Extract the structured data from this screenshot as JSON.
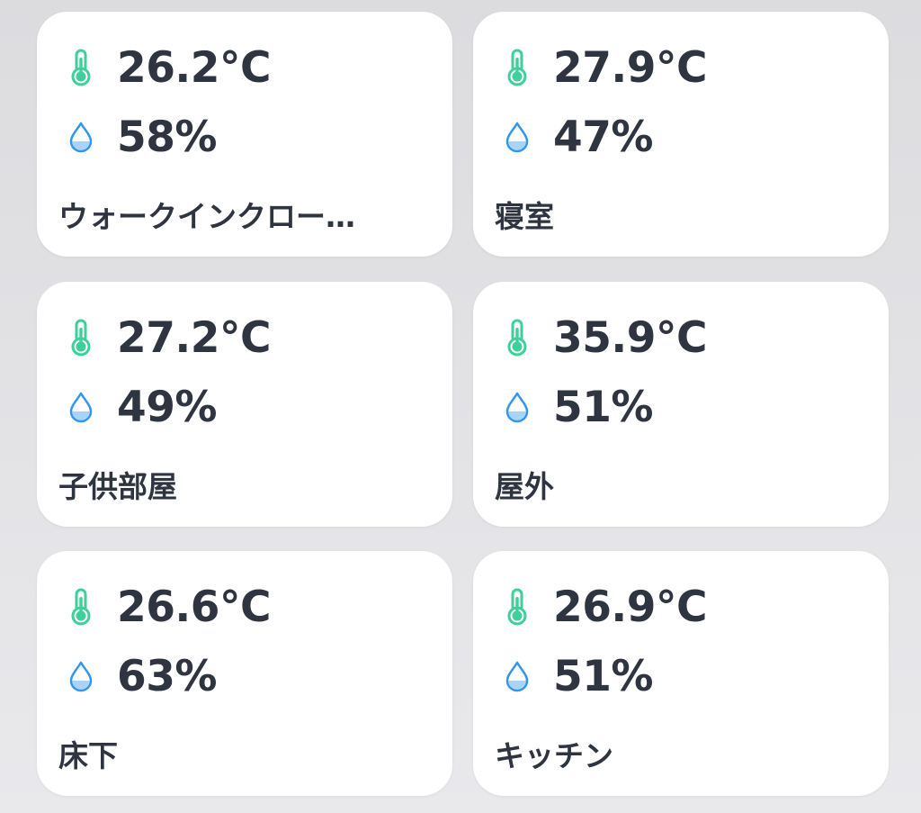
{
  "colors": {
    "temperature_icon": "#3ecf9a",
    "humidity_icon": "#2f96f2",
    "text": "#2e3440",
    "card": "#ffffff"
  },
  "icons": {
    "temperature": "thermometer-icon",
    "humidity": "water-drop-icon"
  },
  "sensors": [
    {
      "temperature": "26.2°C",
      "humidity": "58%",
      "name": "ウォークインクロー…"
    },
    {
      "temperature": "27.9°C",
      "humidity": "47%",
      "name": "寝室"
    },
    {
      "temperature": "27.2°C",
      "humidity": "49%",
      "name": "子供部屋"
    },
    {
      "temperature": "35.9°C",
      "humidity": "51%",
      "name": "屋外"
    },
    {
      "temperature": "26.6°C",
      "humidity": "63%",
      "name": "床下"
    },
    {
      "temperature": "26.9°C",
      "humidity": "51%",
      "name": "キッチン"
    }
  ]
}
